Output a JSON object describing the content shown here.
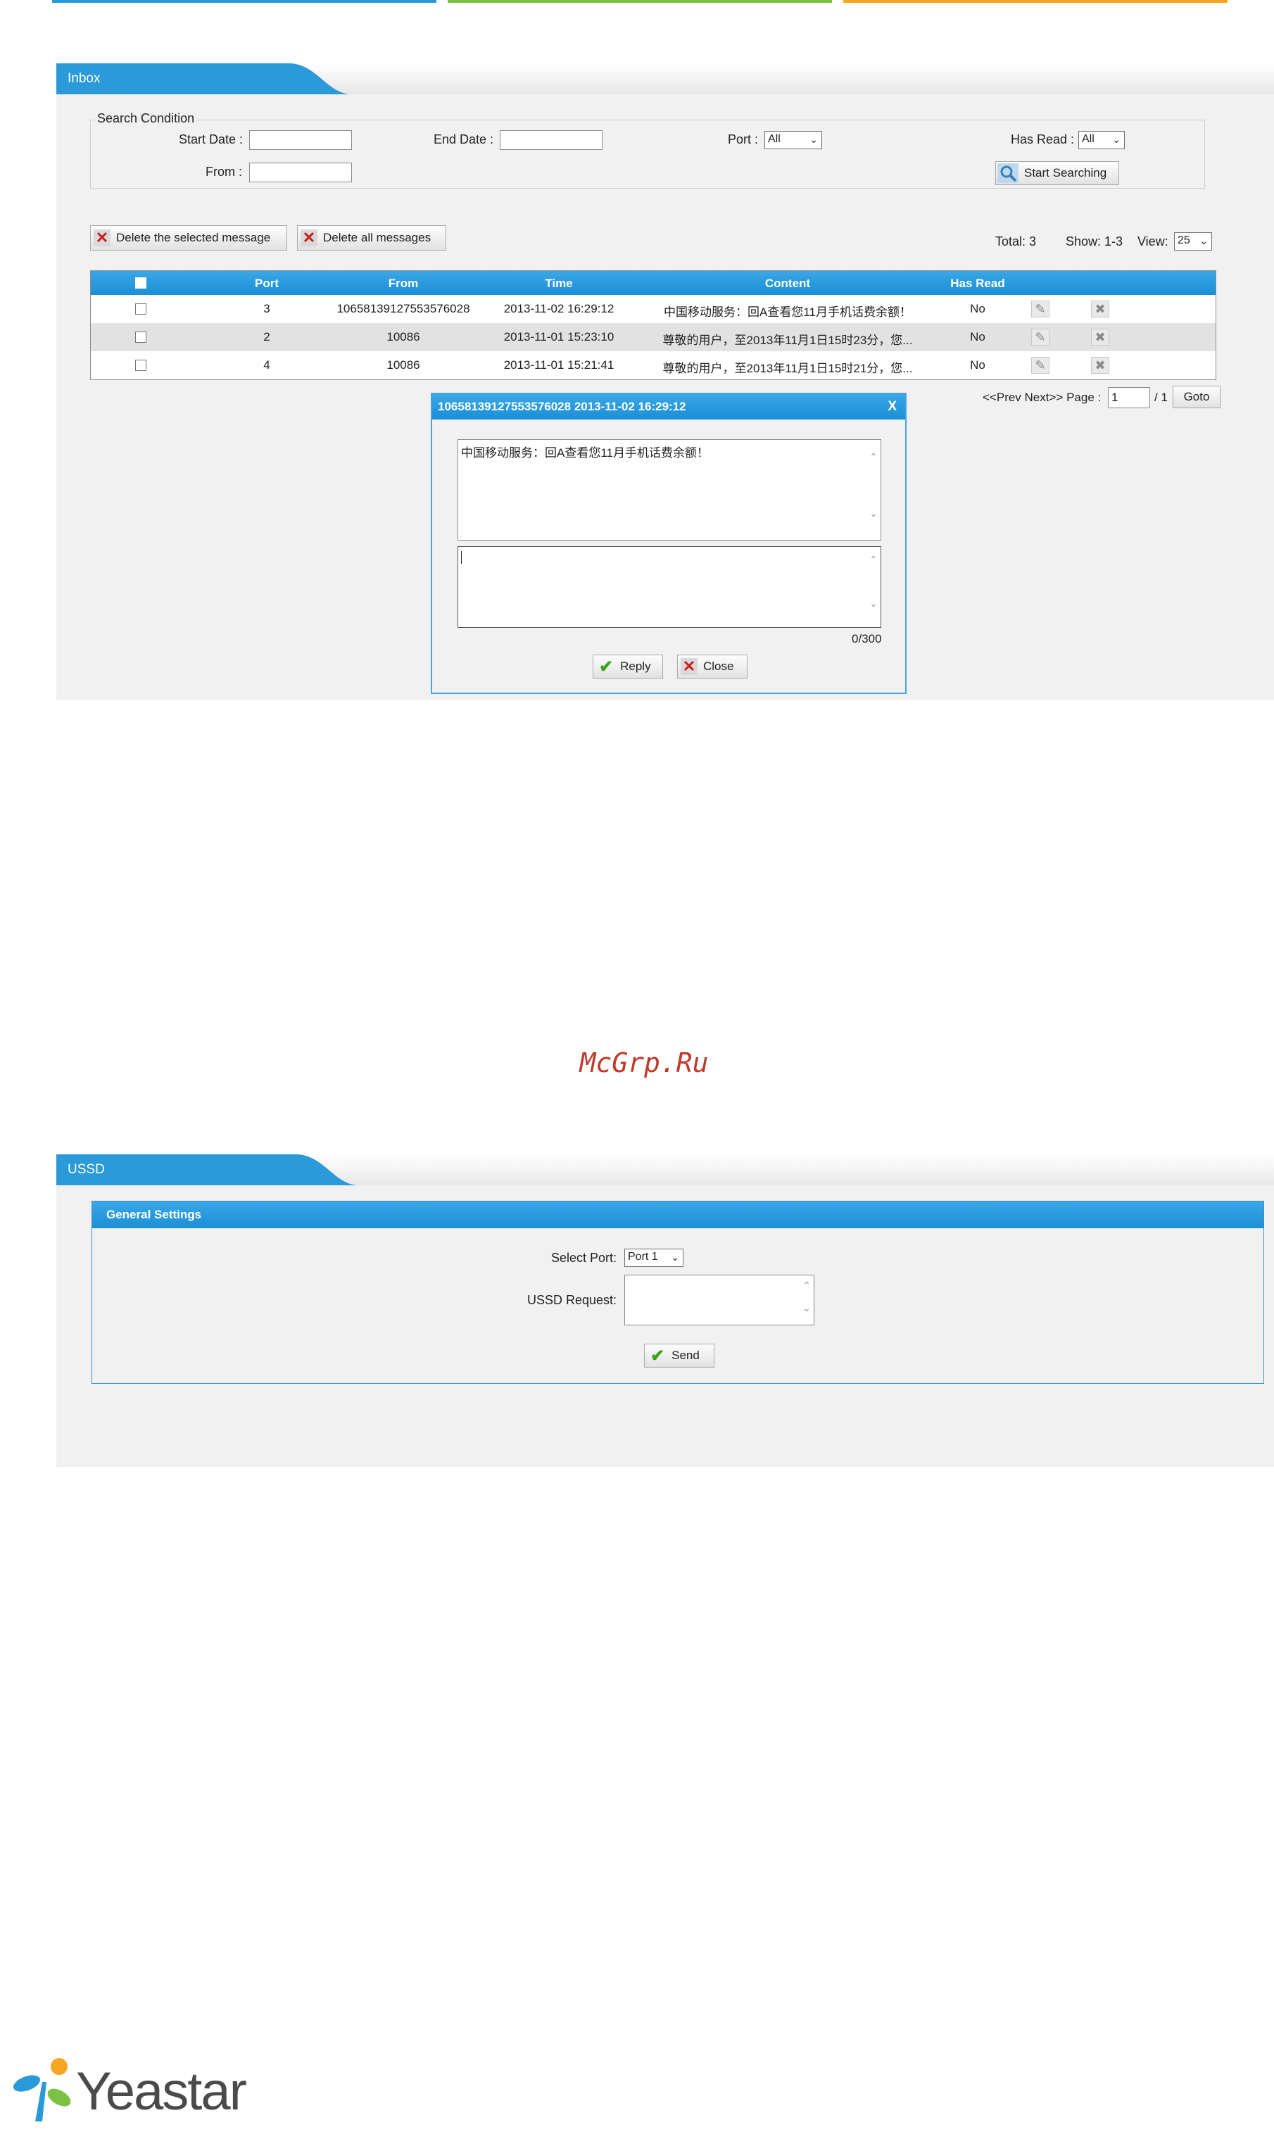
{
  "colors": {
    "accent": "#2a9ad9",
    "top_bars": [
      "#2a9ad9",
      "#7cc242",
      "#f5a623"
    ]
  },
  "inbox": {
    "tab_title": "Inbox",
    "search": {
      "group_label": "Search Condition",
      "start_date_label": "Start Date :",
      "end_date_label": "End Date :",
      "port_label": "Port :",
      "port_value": "All",
      "has_read_label": "Has Read :",
      "has_read_value": "All",
      "from_label": "From :",
      "search_button": "Start Searching"
    },
    "actions": {
      "delete_selected": "Delete the selected message",
      "delete_all": "Delete all messages"
    },
    "summary": {
      "total": "Total: 3",
      "show": "Show: 1-3",
      "view_label": "View:",
      "view_value": "25"
    },
    "table": {
      "headers": [
        "Port",
        "From",
        "Time",
        "Content",
        "Has Read"
      ],
      "rows": [
        {
          "port": "3",
          "from": "10658139127553576028",
          "time": "2013-11-02 16:29:12",
          "content": "中国移动服务：回A查看您11月手机话费余额！",
          "read": "No"
        },
        {
          "port": "2",
          "from": "10086",
          "time": "2013-11-01 15:23:10",
          "content": "尊敬的用户，至2013年11月1日15时23分，您...",
          "read": "No"
        },
        {
          "port": "4",
          "from": "10086",
          "time": "2013-11-01 15:21:41",
          "content": "尊敬的用户，至2013年11月1日15时21分，您...",
          "read": "No"
        }
      ]
    },
    "pager": {
      "prev_next": "<<Prev Next>> Page :",
      "page_value": "1",
      "of": "/ 1",
      "goto": "Goto"
    },
    "dialog": {
      "title": "10658139127553576028 2013-11-02 16:29:12",
      "close_x": "X",
      "message": "中国移动服务：回A查看您11月手机话费余额！",
      "counter": "0/300",
      "reply": "Reply",
      "close": "Close"
    }
  },
  "watermark": "McGrp.Ru",
  "ussd": {
    "tab_title": "USSD",
    "section_title": "General Settings",
    "select_port_label": "Select Port:",
    "select_port_value": "Port 1",
    "ussd_request_label": "USSD Request:",
    "send": "Send"
  },
  "footer": {
    "brand": "Yeastar"
  }
}
